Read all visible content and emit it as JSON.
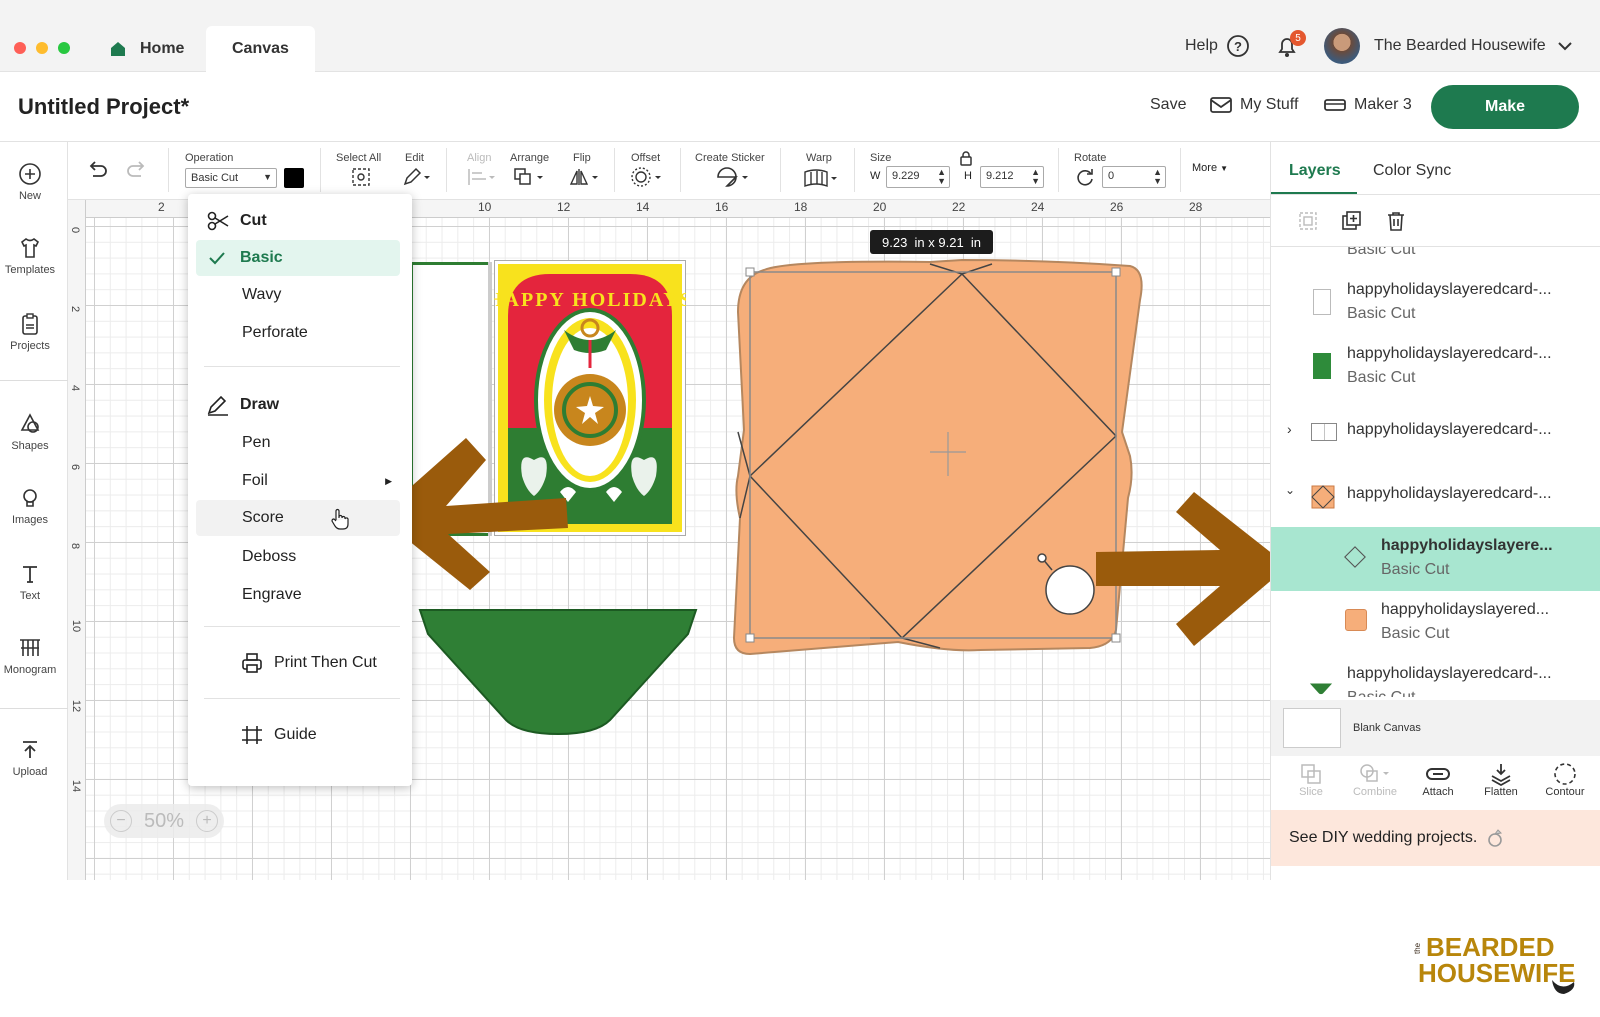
{
  "titlebar": {
    "home_tab": "Home",
    "canvas_tab": "Canvas",
    "help": "Help",
    "notif_count": "5",
    "user": "The Bearded Housewife"
  },
  "header": {
    "project_title": "Untitled Project*",
    "save": "Save",
    "my_stuff": "My Stuff",
    "machine": "Maker 3",
    "make": "Make"
  },
  "left_tools": [
    {
      "label": "New"
    },
    {
      "label": "Templates"
    },
    {
      "label": "Projects"
    },
    {
      "label": "Shapes"
    },
    {
      "label": "Images"
    },
    {
      "label": "Text"
    },
    {
      "label": "Monogram"
    },
    {
      "label": "Upload"
    }
  ],
  "edit_toolbar": {
    "operation_label": "Operation",
    "operation_value": "Basic Cut",
    "select_all": "Select All",
    "edit": "Edit",
    "align": "Align",
    "arrange": "Arrange",
    "flip": "Flip",
    "offset": "Offset",
    "create_sticker": "Create Sticker",
    "warp": "Warp",
    "size": "Size",
    "w_label": "W",
    "w_value": "9.229",
    "h_label": "H",
    "h_value": "9.212",
    "rotate": "Rotate",
    "rotate_value": "0",
    "more": "More"
  },
  "ruler": {
    "top": [
      "2",
      "10",
      "12",
      "14",
      "16",
      "18",
      "20",
      "22",
      "24",
      "26",
      "28"
    ],
    "left": [
      "0",
      "2",
      "4",
      "6",
      "8",
      "10",
      "12",
      "14"
    ]
  },
  "operation_menu": {
    "cut_header": "Cut",
    "cut_items": [
      "Basic",
      "Wavy",
      "Perforate"
    ],
    "draw_header": "Draw",
    "draw_items": [
      "Pen",
      "Foil",
      "Score",
      "Deboss",
      "Engrave"
    ],
    "print_then_cut": "Print Then Cut",
    "guide": "Guide"
  },
  "canvas": {
    "dimension_tooltip": "9.23  in x 9.21  in",
    "zoom": "50%",
    "card_text": "HAPPY HOLIDAYS"
  },
  "right_panel": {
    "tabs": [
      "Layers",
      "Color Sync"
    ],
    "layers": [
      {
        "name": "",
        "sub": "Basic Cut"
      },
      {
        "name": "happyholidayslayeredcard-...",
        "sub": "Basic Cut"
      },
      {
        "name": "happyholidayslayeredcard-...",
        "sub": "Basic Cut"
      },
      {
        "name": "happyholidayslayeredcard-...",
        "sub": ""
      },
      {
        "name": "happyholidayslayeredcard-...",
        "sub": ""
      },
      {
        "name": "happyholidayslayere...",
        "sub": "Basic Cut"
      },
      {
        "name": "happyholidayslayered...",
        "sub": "Basic Cut"
      },
      {
        "name": "happyholidayslayeredcard-...",
        "sub": "Basic Cut"
      }
    ],
    "blank_canvas": "Blank Canvas",
    "bottom_tools": [
      "Slice",
      "Combine",
      "Attach",
      "Flatten",
      "Contour"
    ],
    "banner": "See DIY wedding projects."
  },
  "watermark": {
    "line1": "BEARDED",
    "line2": "HOUSEWIFE",
    "small": "the"
  },
  "colors": {
    "accent": "#1e7a4f",
    "orange": "#f6ae7a",
    "arrow": "#9a5b0c",
    "selected_layer": "#a8e6d0"
  }
}
